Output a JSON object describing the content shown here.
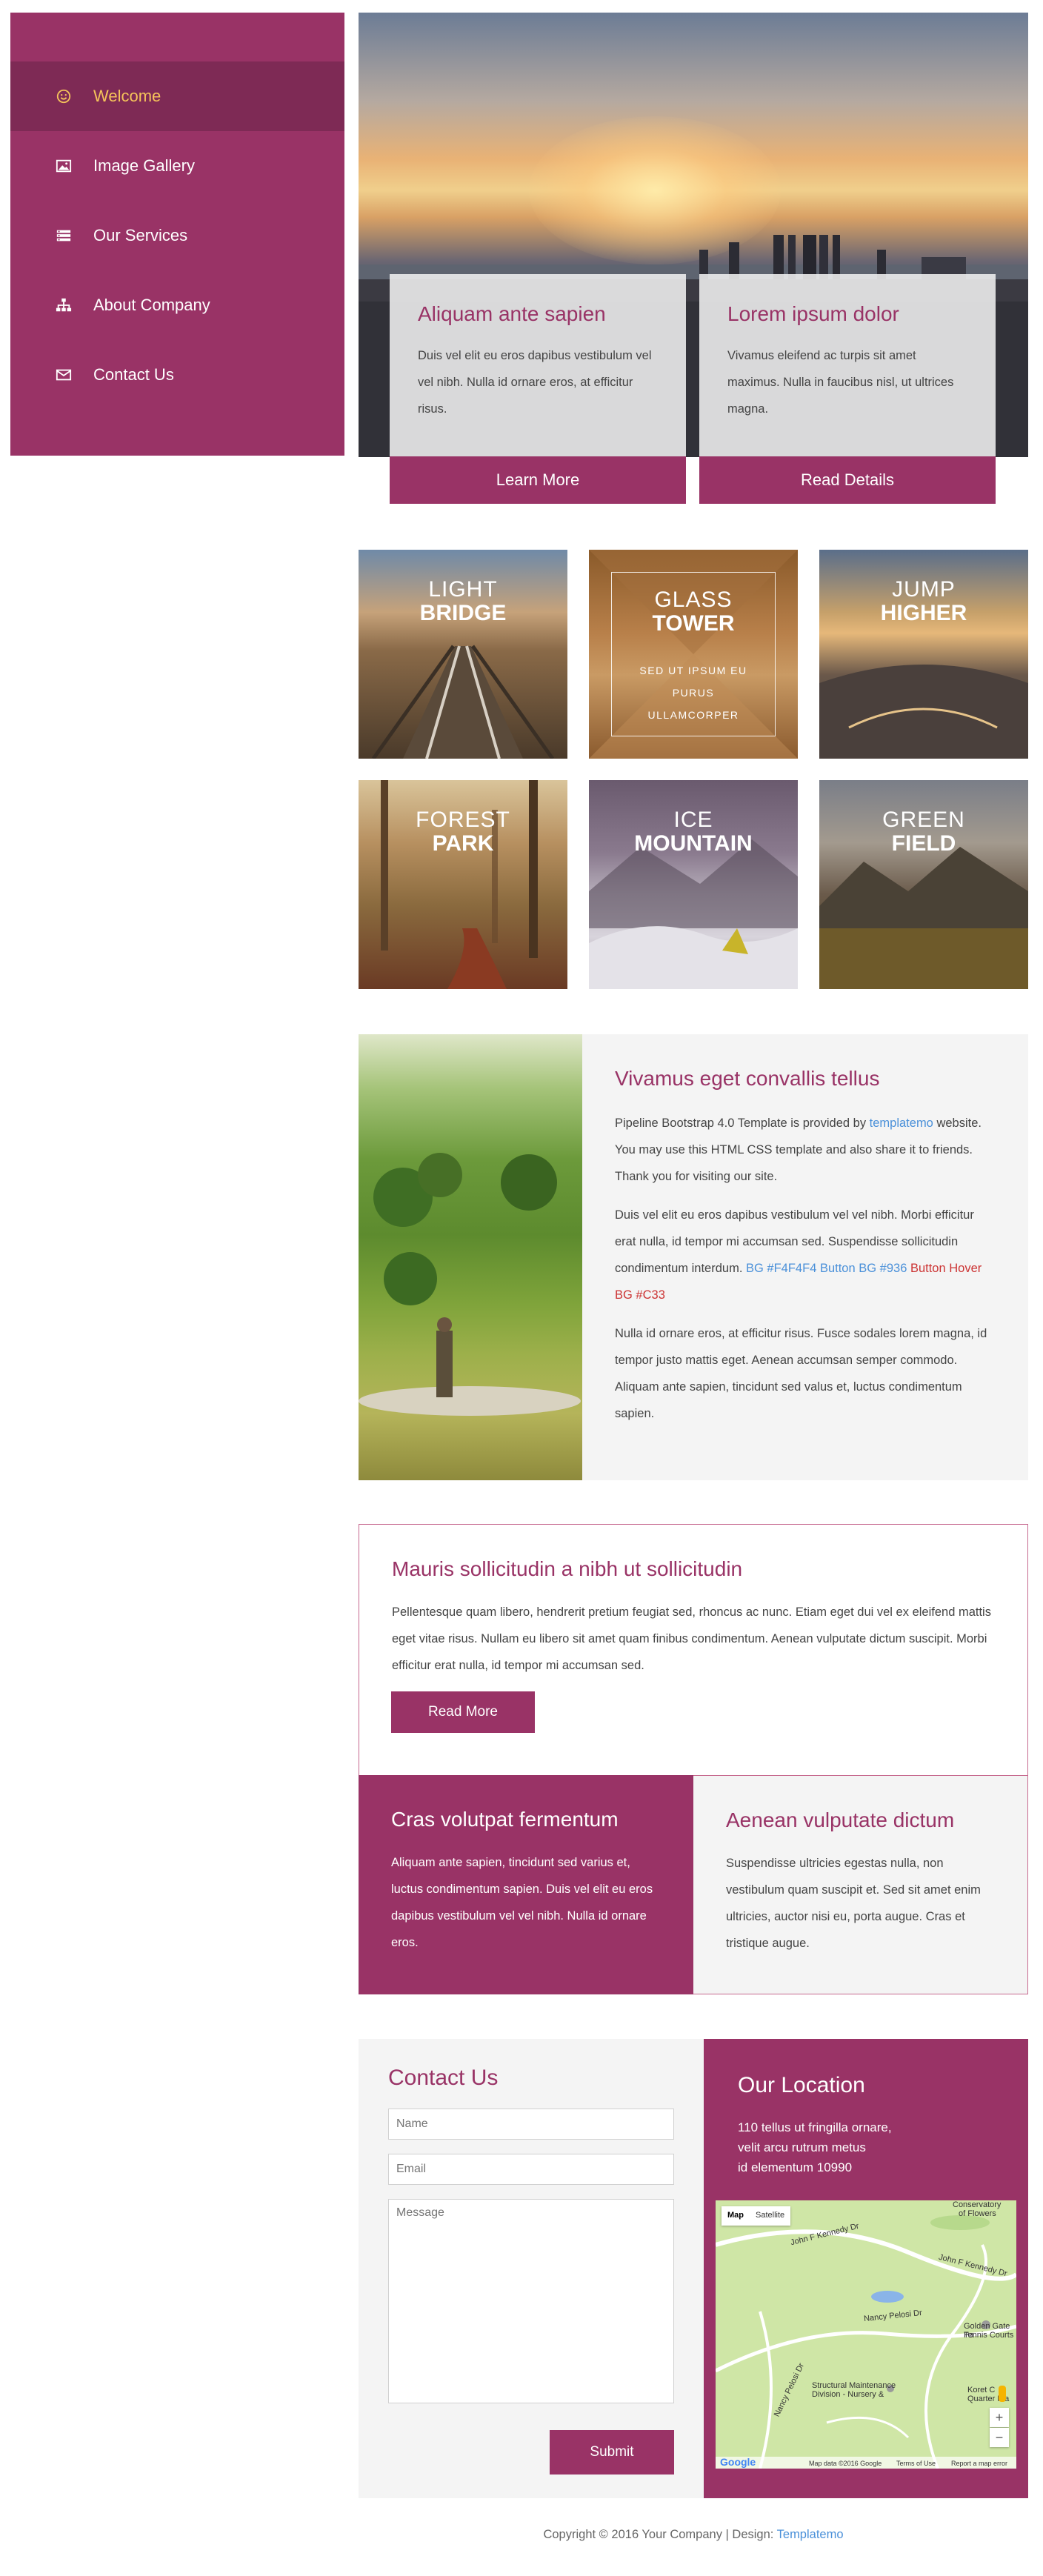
{
  "sidebar": {
    "items": [
      {
        "label": "Welcome",
        "icon": "smile-icon",
        "active": true
      },
      {
        "label": "Image Gallery",
        "icon": "image-icon"
      },
      {
        "label": "Our Services",
        "icon": "list-icon"
      },
      {
        "label": "About Company",
        "icon": "sitemap-icon"
      },
      {
        "label": "Contact Us",
        "icon": "envelope-icon"
      }
    ]
  },
  "hero": {
    "cards": [
      {
        "title": "Aliquam ante sapien",
        "text": "Duis vel elit eu eros dapibus vestibulum vel vel nibh. Nulla id ornare eros, at efficitur risus.",
        "button": "Learn More"
      },
      {
        "title": "Lorem ipsum dolor",
        "text": "Vivamus eleifend ac turpis sit amet maximus. Nulla in faucibus nisl, ut ultrices magna.",
        "button": "Read Details"
      }
    ]
  },
  "gallery": [
    {
      "line1": "LIGHT",
      "line2": "BRIDGE"
    },
    {
      "line1": "GLASS",
      "line2": "TOWER",
      "sub1": "SED UT IPSUM EU",
      "sub2": "PURUS",
      "sub3": "ULLAMCORPER"
    },
    {
      "line1": "JUMP",
      "line2": "HIGHER"
    },
    {
      "line1": "FOREST",
      "line2": "PARK"
    },
    {
      "line1": "ICE",
      "line2": "MOUNTAIN"
    },
    {
      "line1": "GREEN",
      "line2": "FIELD"
    }
  ],
  "about": {
    "title": "Vivamus eget convallis tellus",
    "p1_a": "Pipeline Bootstrap 4.0 Template is provided by ",
    "p1_link": "templatemo",
    "p1_b": " website. You may use this HTML CSS template and also share it to friends. Thank you for visiting our site.",
    "p2_a": "Duis vel elit eu eros dapibus vestibulum vel vel nibh. Morbi efficitur erat nulla, id tempor mi accumsan sed. Suspendisse sollicitudin condimentum interdum. ",
    "p2_blue": "BG #F4F4F4 Button BG #936",
    "p2_red": " Button Hover BG #C33",
    "p3": "Nulla id ornare eros, at efficitur risus. Fusce sodales lorem magna, id tempor justo mattis eget. Aenean accumsan semper commodo. Aliquam ante sapien, tincidunt sed valus et, luctus condimentum sapien."
  },
  "mauris": {
    "title": "Mauris sollicitudin a nibh ut sollicitudin",
    "text": "Pellentesque quam libero, hendrerit pretium feugiat sed, rhoncus ac nunc. Etiam eget dui vel ex eleifend mattis eget vitae risus. Nullam eu libero sit amet quam finibus condimentum. Aenean vulputate dictum suscipit. Morbi efficitur erat nulla, id tempor mi accumsan sed.",
    "button": "Read More"
  },
  "halves": {
    "left": {
      "title": "Cras volutpat fermentum",
      "text": "Aliquam ante sapien, tincidunt sed varius et, luctus condimentum sapien. Duis vel elit eu eros dapibus vestibulum vel vel nibh. Nulla id ornare eros."
    },
    "right": {
      "title": "Aenean vulputate dictum",
      "text": "Suspendisse ultricies egestas nulla, non vestibulum quam suscipit et. Sed sit amet enim ultricies, auctor nisi eu, porta augue. Cras et tristique augue."
    }
  },
  "contact": {
    "title": "Contact Us",
    "name_placeholder": "Name",
    "email_placeholder": "Email",
    "message_placeholder": "Message",
    "submit": "Submit"
  },
  "location": {
    "title": "Our Location",
    "addr1": "110 tellus ut fringilla ornare,",
    "addr2": "velit arcu rutrum metus",
    "addr3": "id elementum 10990",
    "map": {
      "tab_map": "Map",
      "tab_satellite": "Satellite",
      "labels": [
        "Conservatory",
        "of Flowers",
        "John F Kennedy Dr",
        "John F Kennedy Dr",
        "Nancy Pelosi Dr",
        "Nancy Pelosi Dr",
        "Golden Gate Pa",
        "Tennis Courts",
        "Structural Maintenance",
        "Division - Nursery &",
        "Koret C",
        "Quarter Pla",
        "Map data ©2016 Google",
        "Terms of Use",
        "Report a map error",
        "Google"
      ],
      "zoom_in": "+",
      "zoom_out": "−"
    }
  },
  "footer": {
    "text": "Copyright © 2016 Your Company | Design: ",
    "link": "Templatemo"
  },
  "colors": {
    "brand": "#993366",
    "brand_dark": "#7e2a55",
    "active_text": "#f5c35a",
    "light_bg": "#f4f4f4",
    "link": "#4a90d9",
    "hover": "#cc3333"
  }
}
